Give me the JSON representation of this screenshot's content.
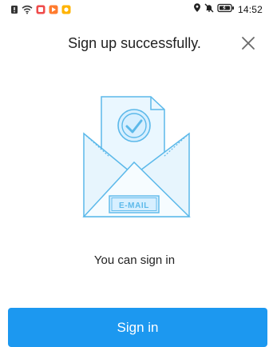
{
  "status_bar": {
    "time": "14:52",
    "left_icons": [
      "alert-icon",
      "wifi-icon",
      "app-red-icon",
      "app-orange-icon",
      "app-yellow-icon"
    ],
    "right_icons": [
      "location-icon",
      "mute-icon",
      "battery-icon"
    ]
  },
  "header": {
    "title": "Sign up successfully."
  },
  "illustration": {
    "badge_text": "E-MAIL"
  },
  "main": {
    "message": "You can sign in"
  },
  "actions": {
    "sign_in_label": "Sign in"
  },
  "colors": {
    "accent": "#1c98f0",
    "illustration_stroke": "#5cb9ea",
    "illustration_fill": "#e7f5fd"
  }
}
